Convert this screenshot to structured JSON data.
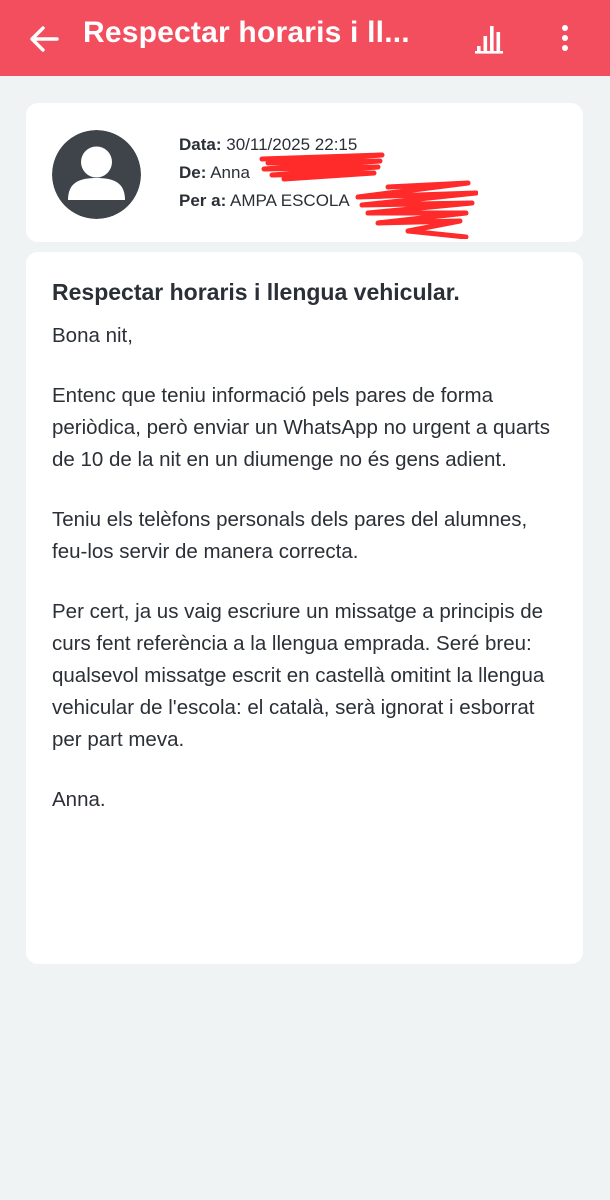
{
  "app_bar": {
    "title": "Respectar horaris i ll...",
    "back_icon": "arrow-left-icon",
    "stats_icon": "bar-chart-icon",
    "more_icon": "more-vertical-icon",
    "background": "#f24e5e"
  },
  "header": {
    "date_label": "Data:",
    "date_value": "30/11/2025 22:15",
    "from_label": "De:",
    "from_value": "Anna",
    "to_label": "Per a:",
    "to_value": "AMPA ESCOLA",
    "redaction_color": "#ff2a2a"
  },
  "message": {
    "subject": "Respectar horaris i llengua vehicular.",
    "paragraphs": [
      "Bona nit,",
      "Entenc que teniu informació pels pares de forma periòdica, però enviar un WhatsApp no urgent a quarts de 10 de la nit en un diumenge no és gens adient.",
      "Teniu els telèfons personals dels pares del alumnes, feu-los servir de manera correcta.",
      "Per cert, ja us vaig escriure un missatge a principis de curs fent referència a la llengua emprada. Seré breu: qualsevol missatge escrit en castellà omitint la llengua vehicular de l'escola: el català, serà ignorat i esborrat per part meva.",
      "Anna."
    ]
  }
}
